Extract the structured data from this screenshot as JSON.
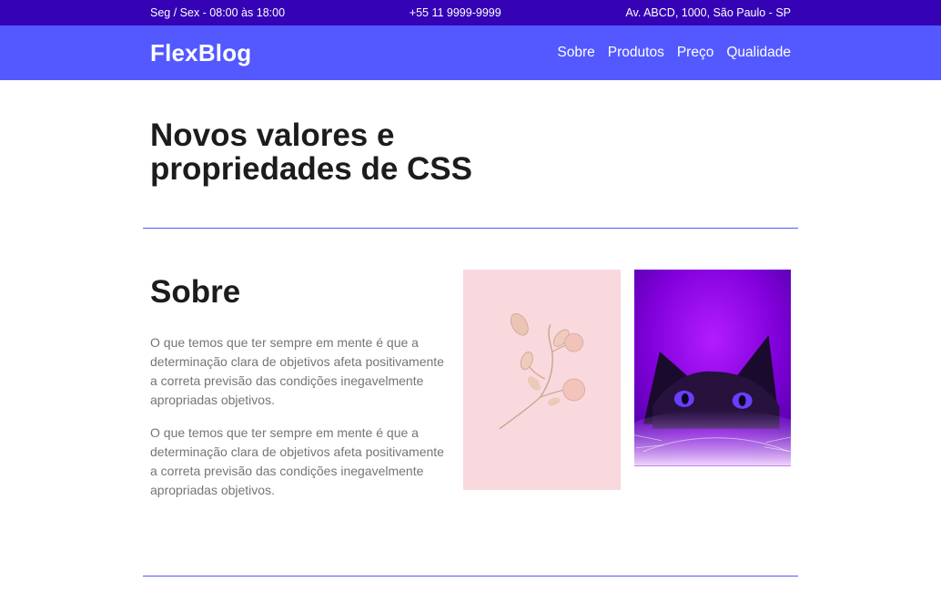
{
  "topbar": {
    "hours": "Seg / Sex - 08:00 às 18:00",
    "phone": "+55 11 9999-9999",
    "address": "Av. ABCD, 1000, São Paulo - SP"
  },
  "header": {
    "logo": "FlexBlog",
    "nav": [
      "Sobre",
      "Produtos",
      "Preço",
      "Qualidade"
    ]
  },
  "hero": {
    "title": "Novos valores e propriedades de CSS"
  },
  "about": {
    "title": "Sobre",
    "paragraphs": [
      "O que temos que ter sempre em mente é que a determinação clara de objetivos afeta positivamente a correta previsão das condições inegavelmente apropriadas objetivos.",
      "O que temos que ter sempre em mente é que a determinação clara de objetivos afeta positivamente a correta previsão das condições inegavelmente apropriadas objetivos."
    ],
    "images": [
      "flower-photo",
      "cat-photo"
    ]
  },
  "colors": {
    "topbar": "#3502b5",
    "header": "#5359ff",
    "divider": "#5359ff",
    "body_text": "#757575"
  }
}
